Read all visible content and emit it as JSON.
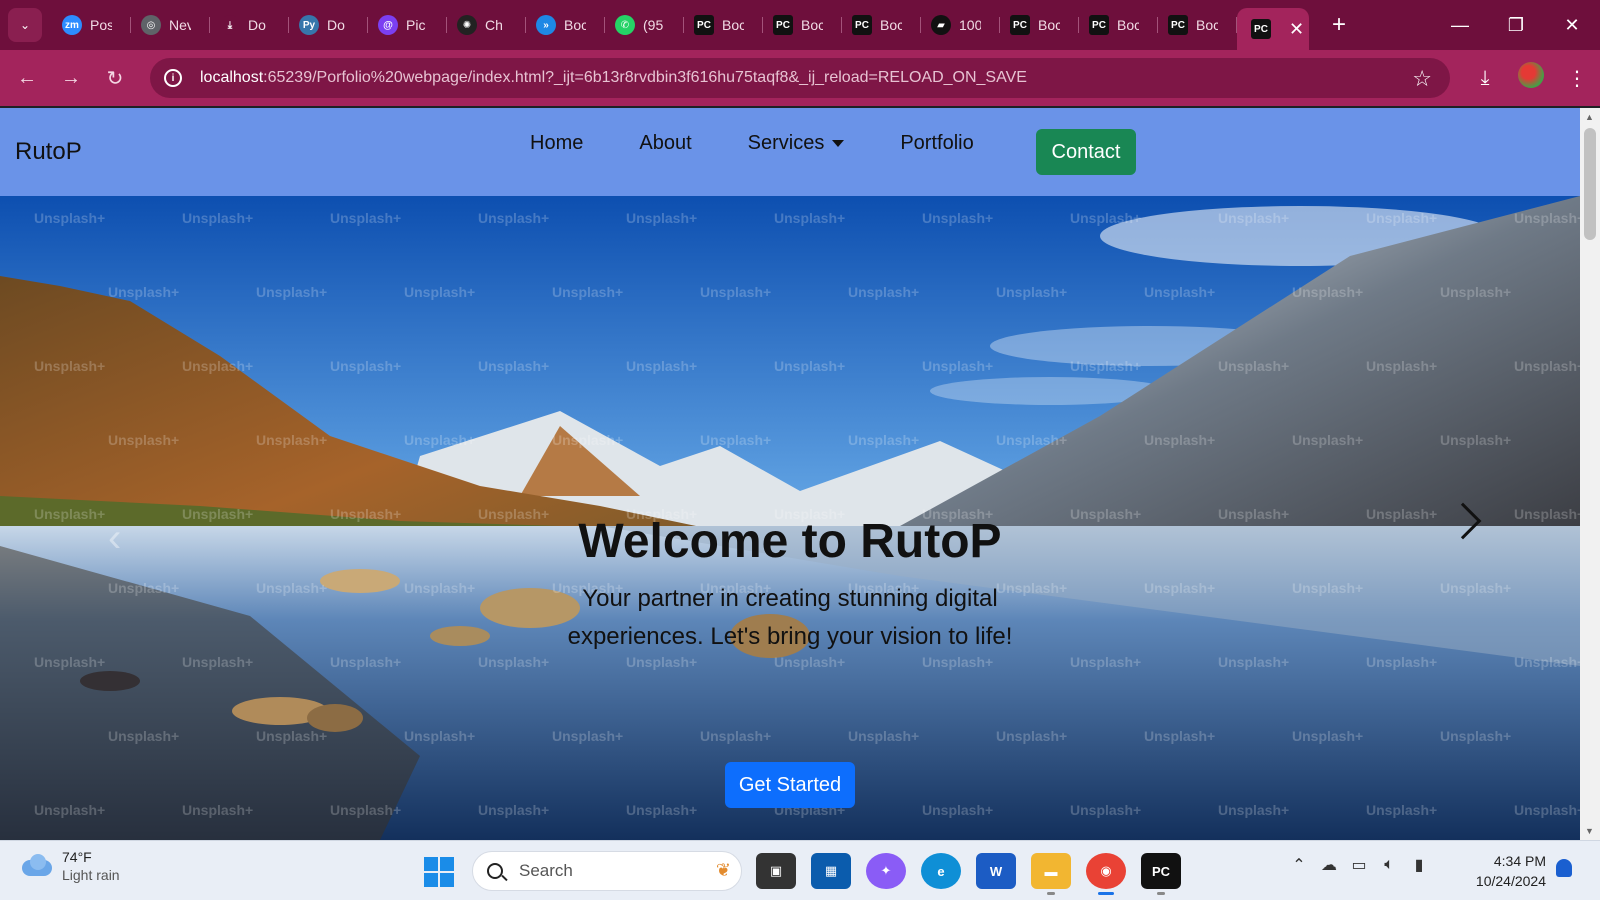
{
  "browser": {
    "tabs": [
      {
        "label": "Pos",
        "icon": "zoom-icon",
        "color": "#2d8cff",
        "glyph": "zm"
      },
      {
        "label": "Nev",
        "icon": "chrome-shield-icon",
        "color": "#5f6368",
        "glyph": "◎"
      },
      {
        "label": "Do",
        "icon": "download-icon",
        "color": "#6e0f3c",
        "glyph": "⤓"
      },
      {
        "label": "Do",
        "icon": "python-icon",
        "color": "#3776ab",
        "glyph": "Py"
      },
      {
        "label": "Pic",
        "icon": "picsart-icon",
        "color": "#7b3ff2",
        "glyph": "@"
      },
      {
        "label": "Ch",
        "icon": "chatgpt-icon",
        "color": "#222222",
        "glyph": "✺"
      },
      {
        "label": "Boc",
        "icon": "bootstrap-icon",
        "color": "#1e88e5",
        "glyph": "»"
      },
      {
        "label": "(95",
        "icon": "whatsapp-icon",
        "color": "#25d366",
        "glyph": "✆"
      },
      {
        "label": "Boc",
        "icon": "pycharm-icon",
        "color": "#111111",
        "glyph": "PC"
      },
      {
        "label": "Boc",
        "icon": "pycharm-icon",
        "color": "#111111",
        "glyph": "PC"
      },
      {
        "label": "Boc",
        "icon": "pycharm-icon",
        "color": "#111111",
        "glyph": "PC"
      },
      {
        "label": "100",
        "icon": "stack-icon",
        "color": "#111111",
        "glyph": "▰"
      },
      {
        "label": "Boc",
        "icon": "pycharm-icon",
        "color": "#111111",
        "glyph": "PC"
      },
      {
        "label": "Boc",
        "icon": "pycharm-icon",
        "color": "#111111",
        "glyph": "PC"
      },
      {
        "label": "Boc",
        "icon": "pycharm-icon",
        "color": "#111111",
        "glyph": "PC"
      }
    ],
    "active_tab_glyph": "PC",
    "url_host": "localhost",
    "url_rest": ":65239/Porfolio%20webpage/index.html?_ijt=6b13r8rvdbin3f616hu75taqf8&_ij_reload=RELOAD_ON_SAVE"
  },
  "site": {
    "brand": "RutoP",
    "nav": {
      "home": "Home",
      "about": "About",
      "services": "Services",
      "portfolio": "Portfolio",
      "contact": "Contact"
    },
    "hero": {
      "title": "Welcome to RutoP",
      "subtitle": "Your partner in creating stunning digital experiences. Let's bring your vision to life!",
      "cta": "Get Started",
      "watermark": "Unsplash+"
    },
    "colors": {
      "navbar": "#6a93e8",
      "contact_button": "#198754",
      "cta_button": "#0d6efd"
    }
  },
  "taskbar": {
    "weather_temp": "74°F",
    "weather_desc": "Light rain",
    "search_placeholder": "Search",
    "time": "4:34 PM",
    "date": "10/24/2024",
    "apps": [
      {
        "name": "task-view-icon",
        "color": "#333333",
        "glyph": "▣"
      },
      {
        "name": "store-icon",
        "color": "#0b5cad",
        "glyph": "▦"
      },
      {
        "name": "copilot-icon",
        "color": "#8a5cf6",
        "glyph": "✦"
      },
      {
        "name": "edge-icon",
        "color": "#0f8fd6",
        "glyph": "e"
      },
      {
        "name": "word-icon",
        "color": "#1c5cc4",
        "glyph": "W"
      },
      {
        "name": "file-explorer-icon",
        "color": "#f2b631",
        "glyph": "▬"
      },
      {
        "name": "chrome-icon",
        "color": "#e94235",
        "glyph": "◉"
      },
      {
        "name": "pycharm-icon",
        "color": "#111111",
        "glyph": "PC"
      }
    ]
  }
}
